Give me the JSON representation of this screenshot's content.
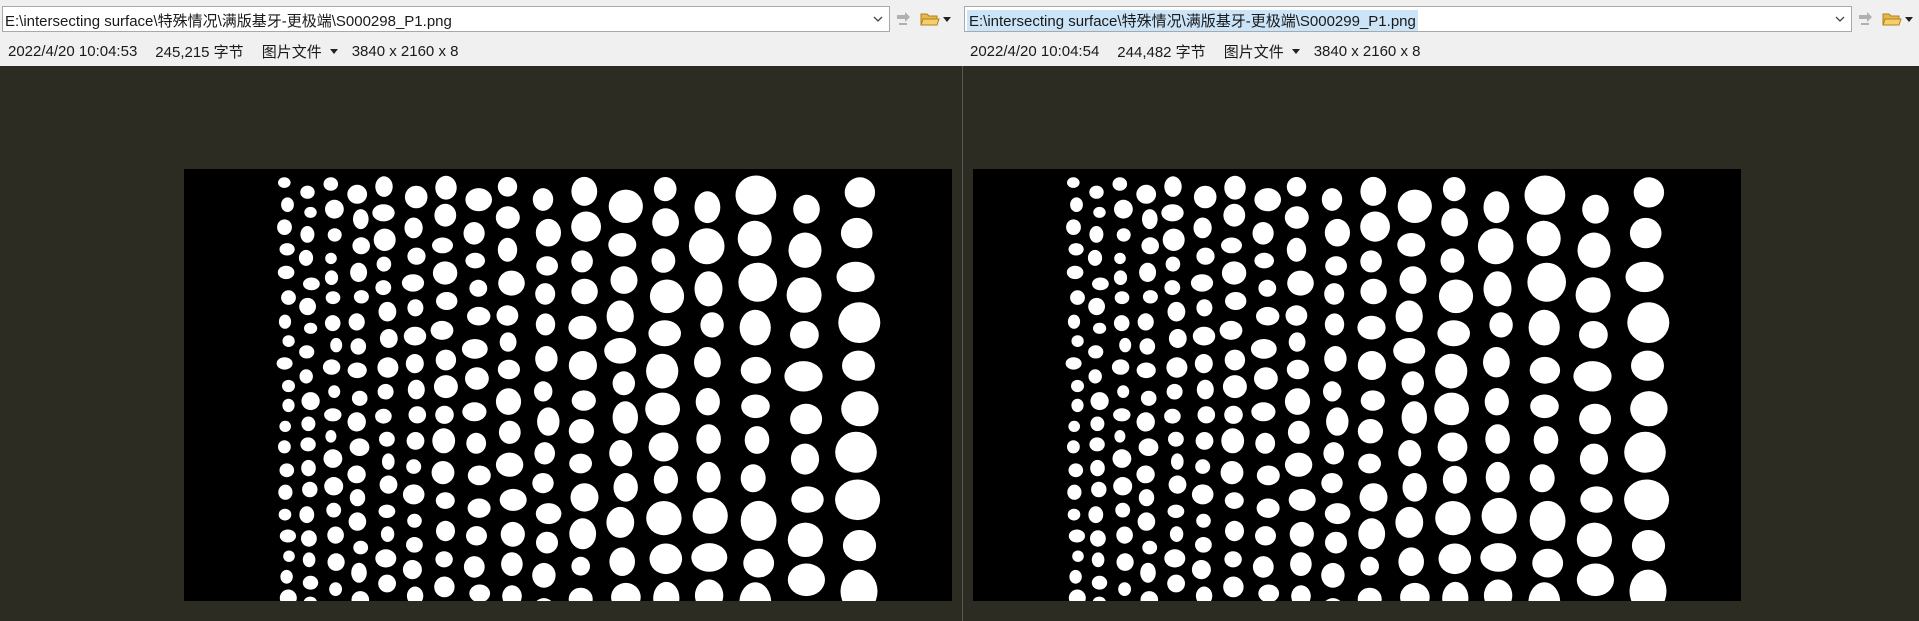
{
  "left": {
    "path": "E:\\intersecting surface\\特殊情况\\满版基牙-更极端\\S000298_P1.png",
    "timestamp": "2022/4/20 10:04:53",
    "size": "245,215 字节",
    "type": "图片文件",
    "dimensions": "3840 x 2160 x 8"
  },
  "right": {
    "path": "E:\\intersecting surface\\特殊情况\\满版基牙-更极端\\S000299_P1.png",
    "timestamp": "2022/4/20 10:04:54",
    "size": "244,482 字节",
    "type": "图片文件",
    "dimensions": "3840 x 2160 x 8"
  },
  "colors": {
    "background": "#2c2c22",
    "toolbar": "#f0f0f0",
    "selection": "#cce4f7"
  }
}
